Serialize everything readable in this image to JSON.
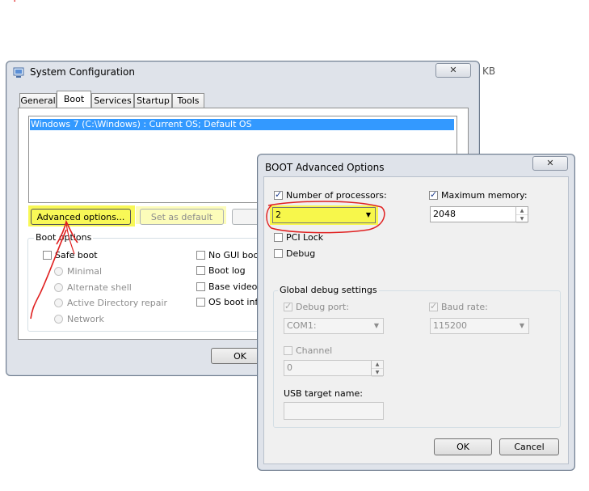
{
  "page": {
    "stray_mark": "·",
    "kb_label": "KB"
  },
  "syscfg": {
    "title": "System Configuration",
    "close": "✕",
    "tabs": [
      "General",
      "Boot",
      "Services",
      "Startup",
      "Tools"
    ],
    "os_entry": "Windows 7 (C:\\Windows) : Current OS; Default OS",
    "advanced_button": "Advanced options...",
    "set_default_button": "Set as default",
    "boot_options_title": "Boot options",
    "safe_boot": "Safe boot",
    "radios": [
      "Minimal",
      "Alternate shell",
      "Active Directory repair",
      "Network"
    ],
    "right_checks": [
      "No GUI boot",
      "Boot log",
      "Base video",
      "OS boot info"
    ],
    "ok_button": "OK"
  },
  "advanced": {
    "title": "BOOT Advanced Options",
    "close": "✕",
    "num_processors_label": "Number of processors:",
    "num_processors_value": "2",
    "max_memory_label": "Maximum memory:",
    "max_memory_value": "2048",
    "pci_lock": "PCI Lock",
    "debug": "Debug",
    "global_debug_title": "Global debug settings",
    "debug_port_label": "Debug port:",
    "debug_port_value": "COM1:",
    "baud_rate_label": "Baud rate:",
    "baud_rate_value": "115200",
    "channel_label": "Channel",
    "channel_value": "0",
    "usb_target_label": "USB target name:",
    "usb_target_value": "",
    "ok_button": "OK",
    "cancel_button": "Cancel"
  },
  "colors": {
    "highlight": "#f7f739",
    "annotation_red": "#e02020",
    "selection": "#3399ff"
  }
}
